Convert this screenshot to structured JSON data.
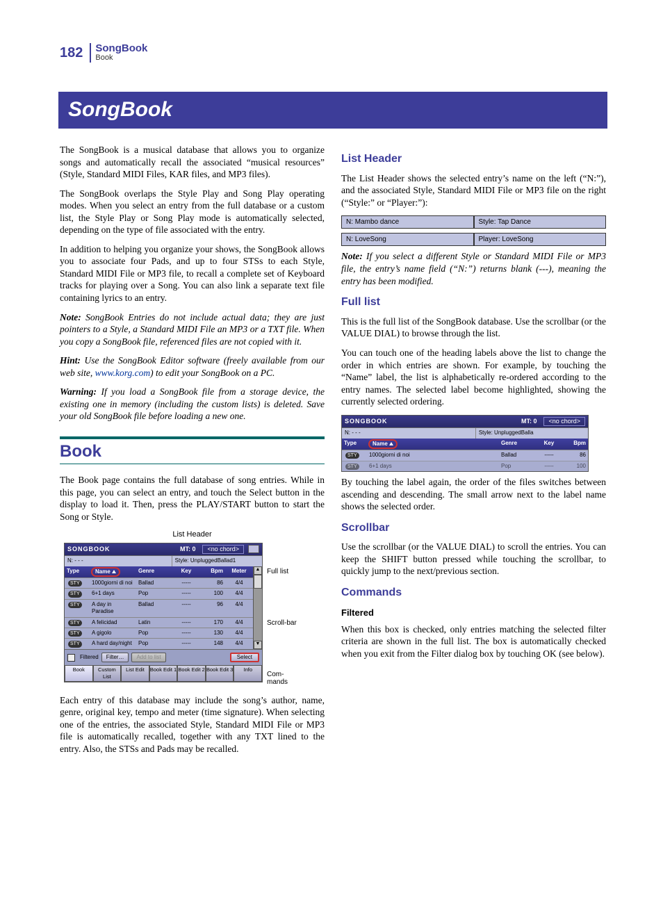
{
  "page_number": "182",
  "running_title": "SongBook",
  "running_subtitle": "Book",
  "chapter_title": "SongBook",
  "left": {
    "p1": "The SongBook is a musical database that allows you to organize songs and automatically recall the associated “musical resources” (Style, Standard MIDI Files, KAR files, and MP3 files).",
    "p2": "The SongBook overlaps the Style Play and Song Play operating modes. When you select an entry from the full database or a custom list, the Style Play or Song Play mode is automatically selected, depending on the type of file associated with the entry.",
    "p3": "In addition to helping you organize your shows, the SongBook allows you to associate four Pads, and up to four STSs to each Style, Standard MIDI File or MP3 file, to recall a complete set of Keyboard tracks for playing over a Song. You can also link a separate text file containing lyrics to an entry.",
    "note_lead": "Note:",
    "note_body": " SongBook Entries do not include actual data; they are just pointers to a Style, a Standard MIDI File an MP3 or a TXT file. When you copy a SongBook file, referenced files are not copied with it.",
    "hint_lead": "Hint:",
    "hint_pre": " Use the SongBook Editor software (freely available from our web site, ",
    "hint_link": "www.korg.com",
    "hint_post": ") to edit your SongBook on a PC.",
    "warn_lead": "Warning:",
    "warn_body": " If you load a SongBook file from a storage device, the existing one in memory (including the custom lists) is deleted. Save your old SongBook file before loading a new one.",
    "h1_book": "Book",
    "book_p1": "The Book page contains the full database of song entries. While in this page, you can select an entry, and touch the Select button in the display to load it. Then, press the PLAY/START button to start the Song or Style.",
    "book_p2": "Each entry of this database may include the song’s author, name, genre, original key, tempo and meter (time signature). When selecting one of the entries, the associated Style, Standard MIDI File or MP3 file is automatically recalled, together with any TXT lined to the entry. Also, the STSs and Pads may be recalled.",
    "caption_list_header": "List Header",
    "side_full_list": "Full list",
    "side_scrollbar": "Scroll-bar",
    "side_commands": "Com-mands"
  },
  "right": {
    "h2_list_header": "List Header",
    "lh_p1": "The List Header shows the selected entry’s name on the left (“N:”), and the associated Style, Standard MIDI File or MP3 file on the right (“Style:” or “Player:”):",
    "strip1_left": "N: Mambo dance",
    "strip1_right": "Style: Tap Dance",
    "strip2_left": "N: LoveSong",
    "strip2_right": "Player: LoveSong",
    "lh_note_lead": "Note:",
    "lh_note_body": " If you select a different Style or Standard MIDI File or MP3 file, the entry’s name field (“N:”) returns blank (---), meaning the entry has been modified.",
    "h2_full_list": "Full list",
    "fl_p1": "This is the full list of the SongBook database. Use the scrollbar (or the VALUE DIAL) to browse through the list.",
    "fl_p2": "You can touch one of the heading labels above the list to change the order in which entries are shown. For example, by touching the “Name” label, the list is alphabetically re-ordered according to the entry names. The selected label become highlighted, showing the currently selected ordering.",
    "fl_after": "By touching the label again, the order of the files switches between ascending and descending. The small arrow next to the label name shows the selected order.",
    "h2_scrollbar": "Scrollbar",
    "sb_p1": "Use the scrollbar (or the VALUE DIAL) to scroll the entries. You can keep the SHIFT button pressed while touching the scrollbar, to quickly jump to the next/previous section.",
    "h2_commands": "Commands",
    "h3_filtered": "Filtered",
    "cmd_p1": "When this box is checked, only entries matching the selected filter criteria are shown in the full list. The box is automatically checked when you exit from the Filter dialog box by touching OK (see below)."
  },
  "lcd_big": {
    "title": "SONGBOOK",
    "mt": "MT: 0",
    "chord": "<no chord>",
    "hdr_n": "N: - - -",
    "hdr_style": "Style: UnpluggedBallad1",
    "cols": {
      "type": "Type",
      "name": "Name",
      "genre": "Genre",
      "key": "Key",
      "bpm": "Bpm",
      "meter": "Meter"
    },
    "rows": [
      {
        "type": "STY",
        "name": "1000giorni di noi",
        "genre": "Ballad",
        "key": "-----",
        "bpm": "86",
        "meter": "4/4"
      },
      {
        "type": "STY",
        "name": "6+1 days",
        "genre": "Pop",
        "key": "-----",
        "bpm": "100",
        "meter": "4/4"
      },
      {
        "type": "STY",
        "name": "A day in Paradise",
        "genre": "Ballad",
        "key": "-----",
        "bpm": "96",
        "meter": "4/4"
      },
      {
        "type": "STY",
        "name": "A felicidad",
        "genre": "Latin",
        "key": "-----",
        "bpm": "170",
        "meter": "4/4"
      },
      {
        "type": "STY",
        "name": "A gigolo",
        "genre": "Pop",
        "key": "-----",
        "bpm": "130",
        "meter": "4/4"
      },
      {
        "type": "STY",
        "name": "A hard day/night",
        "genre": "Pop",
        "key": "-----",
        "bpm": "148",
        "meter": "4/4"
      }
    ],
    "cmds": {
      "filtered": "Filtered",
      "filter": "Filter…",
      "add": "Add to list",
      "select": "Select"
    },
    "tabs": [
      "Book",
      "Custom List",
      "List Edit",
      "Book Edit 1",
      "Book Edit 2",
      "Book Edit 3"
    ],
    "info": "Info"
  },
  "lcd_small": {
    "title": "SONGBOOK",
    "mt": "MT: 0",
    "chord": "<no chord>",
    "hdr_n": "N: - - -",
    "hdr_style": "Style: UnpluggedBalla",
    "cols": {
      "type": "Type",
      "name": "Name",
      "genre": "Genre",
      "key": "Key",
      "bpm": "Bpm"
    },
    "rows": [
      {
        "type": "STY",
        "name": "1000giorni di noi",
        "genre": "Ballad",
        "key": "-----",
        "bpm": "86"
      },
      {
        "type": "STY",
        "name": "6+1 days",
        "genre": "Pop",
        "key": "-----",
        "bpm": "100"
      }
    ]
  }
}
